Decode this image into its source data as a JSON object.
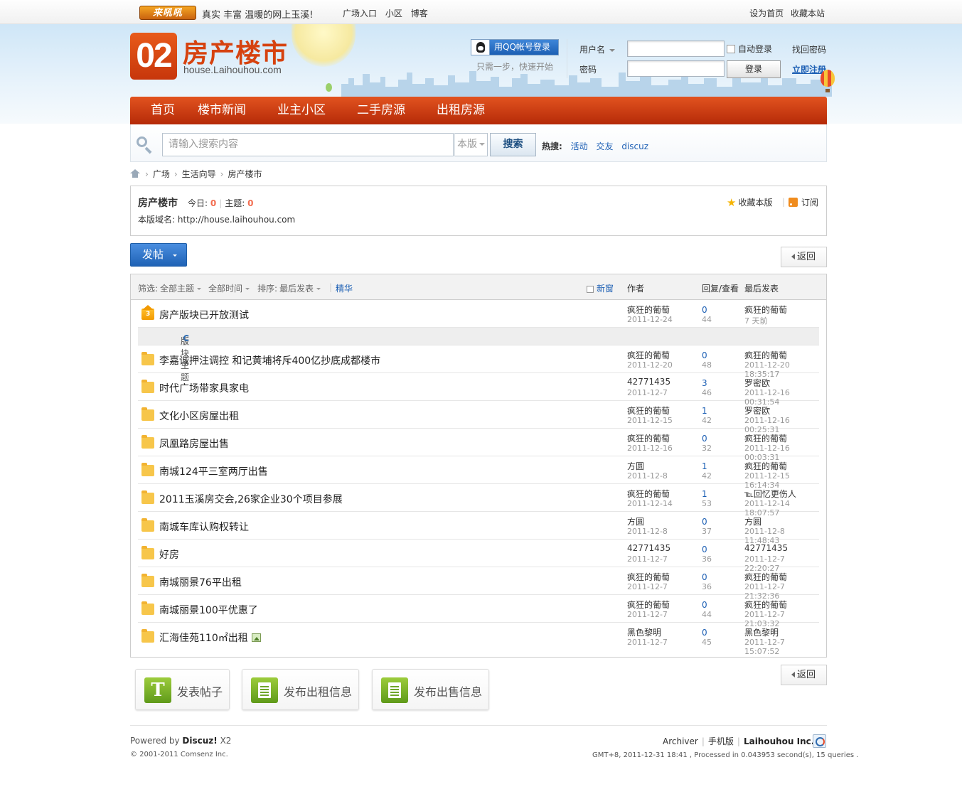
{
  "topbar": {
    "logo": "来吼吼",
    "slogan": "真实 丰富 温暖的网上玉溪!",
    "links": [
      "广场入口",
      "小区",
      "博客"
    ],
    "set_home": "设为首页",
    "favorite": "收藏本站"
  },
  "brand": {
    "number": "02",
    "title": "房产楼市",
    "domain": "house.Laihouhou.com"
  },
  "login": {
    "qq_button": "用QQ帐号登录",
    "qq_tip": "只需一步，快速开始",
    "username_label": "用户名",
    "password_label": "密码",
    "auto_login": "自动登录",
    "login_button": "登录",
    "find_password": "找回密码",
    "register": "立即注册"
  },
  "nav": [
    "首页",
    "楼市新闻",
    "业主小区",
    "二手房源",
    "出租房源"
  ],
  "search": {
    "placeholder": "请输入搜索内容",
    "scope": "本版",
    "button": "搜索",
    "hot_label": "热搜:",
    "hot_terms": [
      "活动",
      "交友",
      "discuz"
    ]
  },
  "breadcrumb": [
    "广场",
    "生活向导",
    "房产楼市"
  ],
  "forum": {
    "name": "房产楼市",
    "today_label": "今日:",
    "today": "0",
    "topics_label": "主题:",
    "topics": "0",
    "domain_label": "本版域名:",
    "domain": "http://house.laihouhou.com",
    "favorite": "收藏本版",
    "subscribe": "订阅"
  },
  "actions": {
    "post": "发帖",
    "back": "返回"
  },
  "thread_header": {
    "filter_label": "筛选:",
    "all_topics": "全部主题",
    "all_time": "全部时间",
    "sort_label": "排序:",
    "last_post": "最后发表",
    "digest": "精华",
    "new_window": "新窗",
    "author": "作者",
    "replies_views": "回复/查看",
    "last_reply": "最后发表"
  },
  "sticky": {
    "title": "房产版块已开放测试",
    "author": "疯狂的葡萄",
    "date": "2011-12-24",
    "replies": "0",
    "views": "44",
    "last_user": "疯狂的葡萄",
    "last_date": "7 天前"
  },
  "section_label": "版块主题",
  "threads": [
    {
      "title": "李嘉诚押注调控 和记黄埔将斥400亿抄底成都楼市",
      "author": "疯狂的葡萄",
      "date": "2011-12-20",
      "replies": "0",
      "views": "48",
      "last_user": "疯狂的葡萄",
      "last_date": "2011-12-20 18:35:17"
    },
    {
      "title": "时代广场带家具家电",
      "author": "42771435",
      "date": "2011-12-7",
      "replies": "3",
      "views": "46",
      "last_user": "罗密欧",
      "last_date": "2011-12-16 00:31:54"
    },
    {
      "title": "文化小区房屋出租",
      "author": "疯狂的葡萄",
      "date": "2011-12-15",
      "replies": "1",
      "views": "42",
      "last_user": "罗密欧",
      "last_date": "2011-12-16 00:25:31"
    },
    {
      "title": "凤凰路房屋出售",
      "author": "疯狂的葡萄",
      "date": "2011-12-16",
      "replies": "0",
      "views": "32",
      "last_user": "疯狂的葡萄",
      "last_date": "2011-12-16 00:03:31"
    },
    {
      "title": "南城124平三室两厅出售",
      "author": "方圆",
      "date": "2011-12-8",
      "replies": "1",
      "views": "42",
      "last_user": "疯狂的葡萄",
      "last_date": "2011-12-15 16:14:34"
    },
    {
      "title": "2011玉溪房交会,26家企业30个项目参展",
      "author": "疯狂的葡萄",
      "date": "2011-12-14",
      "replies": "1",
      "views": "53",
      "last_user": "℡回忆更伤人",
      "last_date": "2011-12-14 18:07:57"
    },
    {
      "title": "南城车库认购权转让",
      "author": "方圆",
      "date": "2011-12-8",
      "replies": "0",
      "views": "37",
      "last_user": "方圆",
      "last_date": "2011-12-8 11:48:43"
    },
    {
      "title": "好房",
      "author": "42771435",
      "date": "2011-12-7",
      "replies": "0",
      "views": "36",
      "last_user": "42771435",
      "last_date": "2011-12-7 22:20:27"
    },
    {
      "title": "南城丽景76平出租",
      "author": "疯狂的葡萄",
      "date": "2011-12-7",
      "replies": "0",
      "views": "36",
      "last_user": "疯狂的葡萄",
      "last_date": "2011-12-7 21:32:36"
    },
    {
      "title": "南城丽景100平优惠了",
      "author": "疯狂的葡萄",
      "date": "2011-12-7",
      "replies": "0",
      "views": "44",
      "last_user": "疯狂的葡萄",
      "last_date": "2011-12-7 21:03:32"
    },
    {
      "title": "汇海佳苑110㎡出租",
      "author": "黑色黎明",
      "date": "2011-12-7",
      "replies": "0",
      "views": "45",
      "last_user": "黑色黎明",
      "last_date": "2011-12-7 15:07:52",
      "has_image": true
    }
  ],
  "bottom_actions": [
    "发表帖子",
    "发布出租信息",
    "发布出售信息"
  ],
  "footer": {
    "powered_by": "Powered by",
    "product": "Discuz!",
    "version": "X2",
    "copyright": "© 2001-2011 Comsenz Inc.",
    "archiver": "Archiver",
    "mobile": "手机版",
    "company": "Laihouhou Inc.",
    "stats": "GMT+8, 2011-12-31 18:41 , Processed in 0.043953 second(s), 15 queries ."
  }
}
